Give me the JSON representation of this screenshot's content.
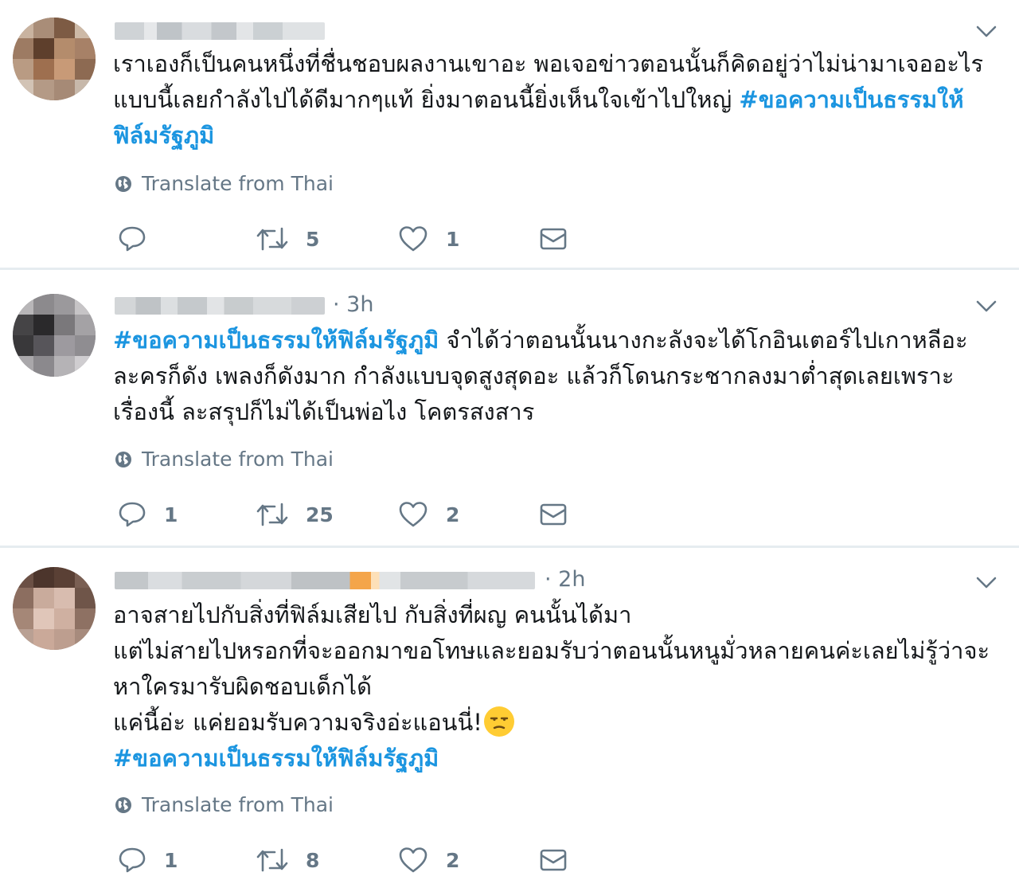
{
  "tweets": [
    {
      "time": "",
      "lines": [
        {
          "text": "เราเองก็เป็นคนหนึ่งที่ชื่นชอบผลงานเขาอะ พอเจอข่าวตอนนั้นก็คิดอยู่ว่าไม่น่ามาเจออะไร",
          "hashtag": ""
        },
        {
          "text": "แบบนี้เลยกำลังไปได้ดีมากๆแท้ ยิ่งมาตอนนี้ยิ่งเห็นใจเข้าไปใหญ่ ",
          "hashtag": "#ขอความเป็นธรรมให้"
        },
        {
          "text": "",
          "hashtag": "ฟิล์มรัฐภูมิ"
        }
      ],
      "translate": "Translate from Thai",
      "reply_count": "",
      "retweet_count": "5",
      "like_count": "1"
    },
    {
      "time": "· 3h",
      "lines": [
        {
          "hashtag": "#ขอความเป็นธรรมให้ฟิล์มรัฐภูมิ",
          "text": " จำได้ว่าตอนนั้นนางกะลังจะได้โกอินเตอร์ไปเกาหลีอะ"
        },
        {
          "text": "ละครก็ดัง เพลงก็ดังมาก กำลังแบบจุดสูงสุดอะ แล้วก็โดนกระชากลงมาต่ำสุดเลยเพราะ",
          "hashtag": ""
        },
        {
          "text": "เรื่องนี้ ละสรุปก็ไม่ได้เป็นพ่อไง โคตรสงสาร",
          "hashtag": ""
        }
      ],
      "translate": "Translate from Thai",
      "reply_count": "1",
      "retweet_count": "25",
      "like_count": "2"
    },
    {
      "time": "· 2h",
      "lines": [
        {
          "text": "อาจสายไปกับสิ่งที่ฟิล์มเสียไป กับสิ่งที่ผญ คนนั้นได้มา",
          "hashtag": ""
        },
        {
          "text": "แต่ไม่สายไปหรอกที่จะออกมาขอโทษและยอมรับว่าตอนนั้นหนูมั่วหลายคนค่ะเลยไม่รู้ว่าจะ",
          "hashtag": ""
        },
        {
          "text": "หาใครมารับผิดชอบเด็กได้",
          "hashtag": ""
        },
        {
          "text": "แค่นี้อ่ะ แค่ยอมรับความจริงอ่ะแอนนี่!",
          "hashtag": ""
        },
        {
          "text": "",
          "hashtag": " #ขอความเป็นธรรมให้ฟิล์มรัฐภูมิ"
        }
      ],
      "translate": "Translate from Thai",
      "reply_count": "1",
      "retweet_count": "8",
      "like_count": "2"
    }
  ],
  "colors": {
    "hashtag": "#1b95e0",
    "meta": "#657786",
    "divider": "#e6ecf0",
    "emoji": "#ffcc33"
  },
  "icons": [
    "globe-icon",
    "reply-icon",
    "retweet-icon",
    "like-icon",
    "message-icon",
    "chevron-down-icon",
    "unamused-face-emoji"
  ]
}
